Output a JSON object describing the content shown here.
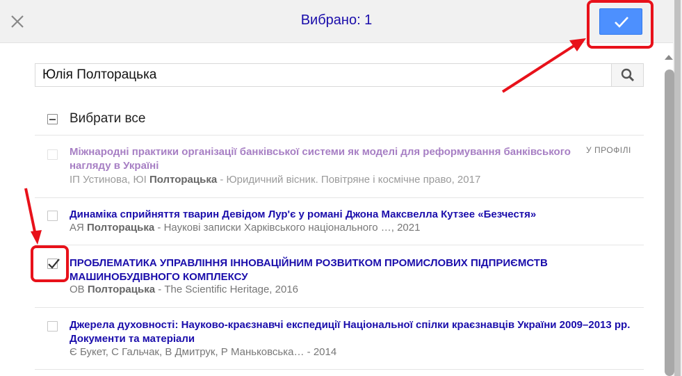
{
  "header": {
    "title": "Вибрано: 1"
  },
  "search": {
    "value": "Юлія Полторацька"
  },
  "select_all": {
    "label": "Вибрати все"
  },
  "items": [
    {
      "title": "Міжнародні практики організації банківської системи як моделі для реформування банківського нагляду в Україні",
      "authors_prefix": "ІП Устинова, ЮІ ",
      "author_bold": "Полторацька",
      "source": " - Юридичний вісник. Повітряне і космічне право, 2017",
      "badge": "У ПРОФІЛІ",
      "state": "disabled"
    },
    {
      "title": "Динаміка сприйняття тварин Девідом Лур'є у романі Джона Максвелла Кутзее «Безчестя»",
      "authors_prefix": "АЯ ",
      "author_bold": "Полторацька",
      "source": " - Наукові записки Харківського національного …, 2021",
      "state": "unchecked"
    },
    {
      "title": "ПРОБЛЕМАТИКА УПРАВЛІННЯ ІННОВАЦІЙНИМ РОЗВИТКОМ ПРОМИСЛОВИХ ПІДПРИЄМСТВ МАШИНОБУДІВНОГО КОМПЛЕКСУ",
      "authors_prefix": "ОВ ",
      "author_bold": "Полторацька",
      "source": " - The Scientific Heritage, 2016",
      "state": "checked"
    },
    {
      "title": "Джерела духовності: Науково-краєзнавчі експедиції Національної спілки краєзнавців України 2009–2013 рр. Документи та матеріали",
      "authors_prefix": "Є Букет, С Гальчак, В Дмитрук, Р Маньковська…",
      "author_bold": "",
      "source": " - 2014",
      "state": "unchecked"
    }
  ],
  "icons": {
    "close": "close-icon",
    "confirm": "checkmark-icon",
    "search": "search-icon"
  },
  "colors": {
    "accent": "#4d90fe",
    "link": "#1a0dab",
    "link_visited_disabled": "#a77fc4",
    "annotation": "#e8111a",
    "header_bg": "#f1f1f1"
  }
}
